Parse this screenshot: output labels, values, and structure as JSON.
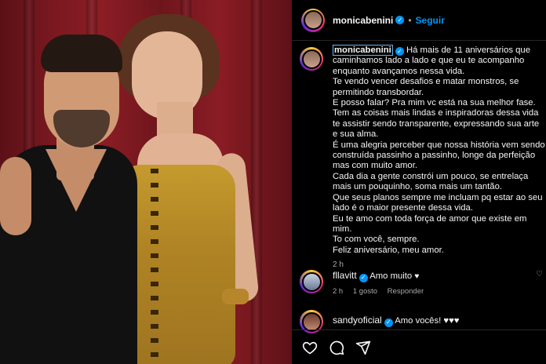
{
  "post": {
    "author": "monicabenini",
    "follow_label": "Seguir",
    "separator": "•",
    "caption": "Há mais de 11 aniversários que caminhamos lado a lado e que eu te acompanho enquanto avançamos nessa vida.\nTe vendo vencer desafios e matar monstros, se permitindo transbordar.\nE posso falar? Pra mim vc está na sua melhor fase. Tem as coisas mais lindas e inspiradoras dessa vida te assistir sendo transparente, expressando sua arte e sua alma.\nÉ uma alegria perceber que nossa história vem sendo construída passinho a passinho, longe da perfeição mas com muito amor.\nCada dia a gente constrói um pouco, se entrelaça mais um pouquinho, soma mais um tantão.\nQue seus planos sempre me incluam pq estar ao seu lado é o maior presente dessa vida.\nEu te amo com toda força de amor que existe em mim.\nTo com você, sempre.\nFeliz aniversário, meu amor.",
    "time": "2 h"
  },
  "comments": [
    {
      "user": "fllavitt",
      "text": "Amo muito",
      "heart": "♥",
      "time": "2 h",
      "likes": "1 gosto",
      "reply": "Responder"
    },
    {
      "user": "sandyoficial",
      "text": "Amo vocês! ♥♥♥",
      "heart": "",
      "time": "",
      "likes": "",
      "reply": ""
    }
  ],
  "colors": {
    "accent": "#0095f6",
    "background": "#000000",
    "text": "#f5f5f5",
    "muted": "#a8a8a8"
  },
  "icons": [
    "heart-icon",
    "comment-icon",
    "share-icon",
    "verified-badge-icon"
  ]
}
